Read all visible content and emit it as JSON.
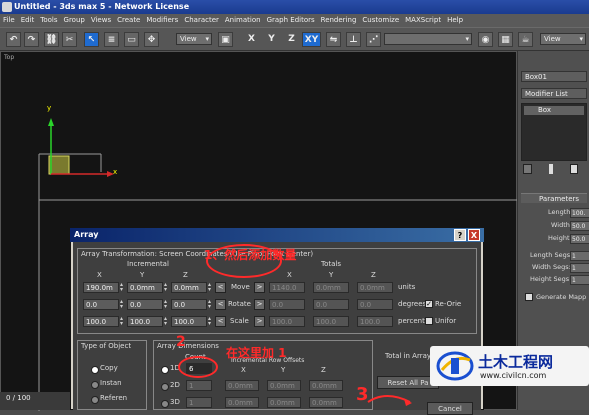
{
  "window": {
    "title": "Untitled - 3ds max 5 - Network License"
  },
  "menu": [
    "File",
    "Edit",
    "Tools",
    "Group",
    "Views",
    "Create",
    "Modifiers",
    "Character",
    "Animation",
    "Graph Editors",
    "Rendering",
    "Customize",
    "MAXScript",
    "Help"
  ],
  "toolbar": {
    "view_dropdown": "View",
    "axes": [
      "X",
      "Y",
      "Z",
      "XY"
    ],
    "view_dropdown_right": "View"
  },
  "viewport": {
    "label": "Top",
    "axis_y": "y",
    "axis_x": "x"
  },
  "right_panel": {
    "object_name": "Box01",
    "modifier_list": "Modifier List",
    "stack_item": "Box",
    "rollout_title": "Parameters",
    "params": [
      {
        "label": "Length:",
        "value": "100."
      },
      {
        "label": "Width:",
        "value": "50.0"
      },
      {
        "label": "Height:",
        "value": "50.0"
      },
      {
        "label": "Length Segs:",
        "value": "1"
      },
      {
        "label": "Width Segs:",
        "value": "1"
      },
      {
        "label": "Height Segs:",
        "value": "1"
      }
    ],
    "gen_mapping": "Generate Mapp"
  },
  "dialog": {
    "title": "Array",
    "help": "?",
    "close": "X",
    "transform_group": "Array Transformation: Screen Coordinates (Use Pivot Point Center)",
    "incremental": "Incremental",
    "totals": "Totals",
    "xyz": [
      "X",
      "Y",
      "Z"
    ],
    "rows": [
      {
        "label": "Move",
        "inc": [
          "190.0m",
          "0.0mm",
          "0.0mm"
        ],
        "tot": [
          "1140.0",
          "0.0mm",
          "0.0mm"
        ],
        "unit": "units"
      },
      {
        "label": "Rotate",
        "inc": [
          "0.0",
          "0.0",
          "0.0"
        ],
        "tot": [
          "0.0",
          "0.0",
          "0.0"
        ],
        "unit": "degrees"
      },
      {
        "label": "Scale",
        "inc": [
          "100.0",
          "100.0",
          "100.0"
        ],
        "tot": [
          "100.0",
          "100.0",
          "100.0"
        ],
        "unit": "percent"
      }
    ],
    "re_orient": "Re-Orie",
    "uniform": "Unifor",
    "type_group": "Type of Object",
    "types": [
      "Copy",
      "Instan",
      "Referen"
    ],
    "dim_group": "Array Dimensions",
    "count_label": "Count",
    "row_offsets_label": "Incremental Row Offsets",
    "dims": [
      {
        "label": "1D",
        "count": "6"
      },
      {
        "label": "2D",
        "count": "1",
        "vals": [
          "0.0mm",
          "0.0mm",
          "0.0mm"
        ]
      },
      {
        "label": "3D",
        "count": "1",
        "vals": [
          "0.0mm",
          "0.0mm",
          "0.0mm"
        ]
      }
    ],
    "total_in_array": "Total in Array:",
    "reset_all": "Reset All Pa",
    "cancel": "Cancel"
  },
  "annotations": {
    "note1": "1、然后添加数量",
    "note2": "在这里加 1",
    "marker2": "2",
    "marker3": "3"
  },
  "timeline": {
    "frame": "0 / 100"
  },
  "watermark": {
    "cn": "土木工程网",
    "url": "www.civilcn.com"
  },
  "colors": {
    "accent": "#1f6bd0",
    "annotation": "#ff2a2a"
  }
}
